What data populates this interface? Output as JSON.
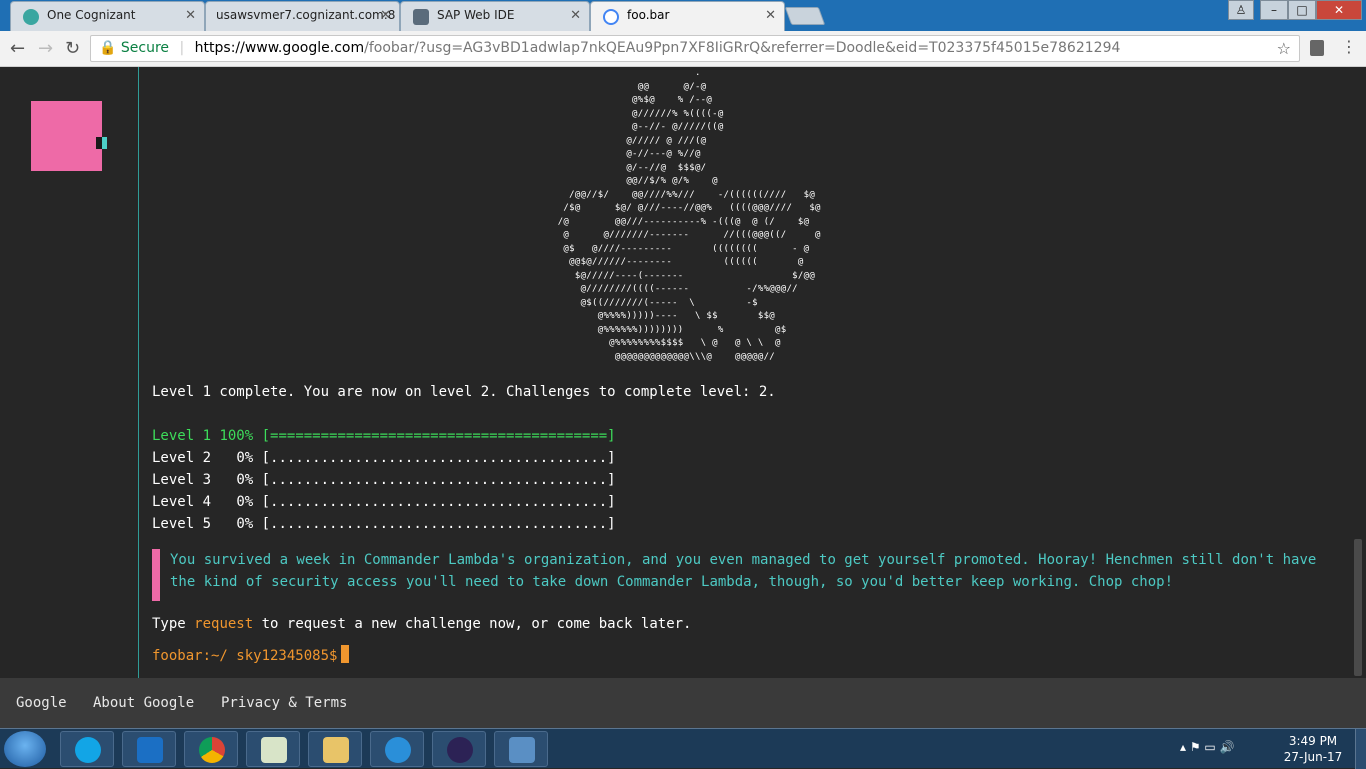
{
  "browser": {
    "tabs": [
      {
        "title": "One Cognizant",
        "icon": "cognizant-icon"
      },
      {
        "title": "usawsvmer7.cognizant.com:8",
        "icon": "document-icon"
      },
      {
        "title": "SAP Web IDE",
        "icon": "cloud-icon"
      },
      {
        "title": "foo.bar",
        "icon": "google-icon",
        "active": true
      }
    ],
    "secure_label": "Secure",
    "url_host": "https://www.google.com",
    "url_rest": "/foobar/?usg=AG3vBD1adwlap7nkQEAu9Ppn7XF8IiGRrQ&referrer=Doodle&eid=T023375f45015e78621294"
  },
  "terminal": {
    "ascii_art": "                         .\n               @@      @/-@\n              @%$@    % /--@\n              @//////% %((((-@\n              @--//- @/////((@\n             @///// @ ///(@\n             @-//---@ %//@\n             @/--//@  $$$@/\n             @@//$/% @/%    @\n   /@@//$/    @@////%%///    -/((((((////   $@\n  /$@      $@/ @///----//@@%   ((((@@@////   $@\n /@        @@///----------% -(((@  @ (/    $@\n  @      @///////-------      //(((@@@((/     @\n  @$   @////---------       ((((((((      - @\n   @@$@//////--------         ((((((       @\n    $@/////----(-------                   $/@@\n     @////////((((------          -/%%@@@//\n     @$((///////(-----  \\         -$\n        @%%%%)))))----   \\ $$       $$@\n        @%%%%%%))))))))      %         @$\n          @%%%%%%%%$$$$   \\ @   @ \\ \\  @\n           @@@@@@@@@@@@@\\\\\\@    @@@@@//",
    "level_message": "Level 1 complete. You are now on level 2. Challenges to complete level: 2.",
    "levels": [
      {
        "label": "Level 1",
        "percent": "100%",
        "bar": "[========================================]"
      },
      {
        "label": "Level 2",
        "percent": "0%",
        "bar": "[........................................]"
      },
      {
        "label": "Level 3",
        "percent": "0%",
        "bar": "[........................................]"
      },
      {
        "label": "Level 4",
        "percent": "0%",
        "bar": "[........................................]"
      },
      {
        "label": "Level 5",
        "percent": "0%",
        "bar": "[........................................]"
      }
    ],
    "note": "You survived a week in Commander Lambda's organization, and you even managed to get yourself promoted. Hooray! Henchmen still don't have the kind of security access you'll need to take down Commander Lambda, though, so you'd better keep working. Chop chop!",
    "type_prefix": "Type",
    "type_command": "request",
    "type_suffix": "to request a new challenge now, or come back later.",
    "prompt": "foobar:~/ sky12345085$"
  },
  "footer": {
    "links": [
      "Google",
      "About Google",
      "Privacy & Terms"
    ]
  },
  "taskbar": {
    "apps": [
      "skype-icon",
      "outlook-icon",
      "chrome-icon",
      "notepad-icon",
      "file-explorer-icon",
      "internet-explorer-icon",
      "eclipse-icon",
      "remote-desktop-icon"
    ],
    "time": "3:49 PM",
    "date": "27-Jun-17"
  },
  "colors": {
    "accent_pink": "#ee6aa7",
    "accent_teal": "#4dc9c3",
    "accent_green": "#3ddc5a",
    "accent_orange": "#f0962e"
  }
}
